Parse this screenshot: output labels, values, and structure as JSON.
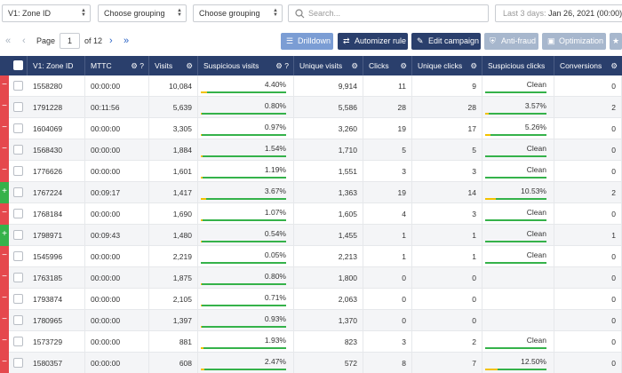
{
  "filters": {
    "zone_select": "V1: Zone ID",
    "grouping_1": "Choose grouping",
    "grouping_2": "Choose grouping",
    "search_placeholder": "Search...",
    "date_label": "Last 3 days:",
    "date_value": "Jan 26, 2021 (00:00) - J"
  },
  "pager": {
    "page_label": "Page",
    "current_page": "1",
    "of_label": "of 12"
  },
  "actions": {
    "drilldown": "Drilldown",
    "automizer_rule": "Automizer rule",
    "edit_campaign": "Edit campaign",
    "anti_fraud": "Anti-fraud",
    "optimization": "Optimization"
  },
  "table": {
    "headers": [
      "V1: Zone ID",
      "MTTC",
      "Visits",
      "Suspicious visits",
      "Unique visits",
      "Clicks",
      "Unique clicks",
      "Suspicious clicks",
      "Conversions"
    ],
    "rows": [
      {
        "status": "minus",
        "zone": "1558280",
        "mttc": "00:00:00",
        "visits": "10,084",
        "susp_visits": "4.40%",
        "sv_frac": 0.044,
        "unique_visits": "9,914",
        "clicks": "11",
        "unique_clicks": "9",
        "susp_clicks": "Clean",
        "sc_frac": 0,
        "conversions": "0"
      },
      {
        "status": "minus",
        "zone": "1791228",
        "mttc": "00:11:56",
        "visits": "5,639",
        "susp_visits": "0.80%",
        "sv_frac": 0.008,
        "unique_visits": "5,586",
        "clicks": "28",
        "unique_clicks": "28",
        "susp_clicks": "3.57%",
        "sc_frac": 0.0357,
        "conversions": "2"
      },
      {
        "status": "minus",
        "zone": "1604069",
        "mttc": "00:00:00",
        "visits": "3,305",
        "susp_visits": "0.97%",
        "sv_frac": 0.0097,
        "unique_visits": "3,260",
        "clicks": "19",
        "unique_clicks": "17",
        "susp_clicks": "5.26%",
        "sc_frac": 0.0526,
        "conversions": "0"
      },
      {
        "status": "minus",
        "zone": "1568430",
        "mttc": "00:00:00",
        "visits": "1,884",
        "susp_visits": "1.54%",
        "sv_frac": 0.0154,
        "unique_visits": "1,710",
        "clicks": "5",
        "unique_clicks": "5",
        "susp_clicks": "Clean",
        "sc_frac": 0,
        "conversions": "0"
      },
      {
        "status": "minus",
        "zone": "1776626",
        "mttc": "00:00:00",
        "visits": "1,601",
        "susp_visits": "1.19%",
        "sv_frac": 0.0119,
        "unique_visits": "1,551",
        "clicks": "3",
        "unique_clicks": "3",
        "susp_clicks": "Clean",
        "sc_frac": 0,
        "conversions": "0"
      },
      {
        "status": "plus",
        "zone": "1767224",
        "mttc": "00:09:17",
        "visits": "1,417",
        "susp_visits": "3.67%",
        "sv_frac": 0.0367,
        "unique_visits": "1,363",
        "clicks": "19",
        "unique_clicks": "14",
        "susp_clicks": "10.53%",
        "sc_frac": 0.1053,
        "conversions": "2"
      },
      {
        "status": "minus",
        "zone": "1768184",
        "mttc": "00:00:00",
        "visits": "1,690",
        "susp_visits": "1.07%",
        "sv_frac": 0.0107,
        "unique_visits": "1,605",
        "clicks": "4",
        "unique_clicks": "3",
        "susp_clicks": "Clean",
        "sc_frac": 0,
        "conversions": "0"
      },
      {
        "status": "plus",
        "zone": "1798971",
        "mttc": "00:09:43",
        "visits": "1,480",
        "susp_visits": "0.54%",
        "sv_frac": 0.0054,
        "unique_visits": "1,455",
        "clicks": "1",
        "unique_clicks": "1",
        "susp_clicks": "Clean",
        "sc_frac": 0,
        "conversions": "1"
      },
      {
        "status": "minus",
        "zone": "1545996",
        "mttc": "00:00:00",
        "visits": "2,219",
        "susp_visits": "0.05%",
        "sv_frac": 0.0005,
        "unique_visits": "2,213",
        "clicks": "1",
        "unique_clicks": "1",
        "susp_clicks": "Clean",
        "sc_frac": 0,
        "conversions": "0"
      },
      {
        "status": "minus",
        "zone": "1763185",
        "mttc": "00:00:00",
        "visits": "1,875",
        "susp_visits": "0.80%",
        "sv_frac": 0.008,
        "unique_visits": "1,800",
        "clicks": "0",
        "unique_clicks": "0",
        "susp_clicks": "",
        "sc_frac": null,
        "conversions": "0"
      },
      {
        "status": "minus",
        "zone": "1793874",
        "mttc": "00:00:00",
        "visits": "2,105",
        "susp_visits": "0.71%",
        "sv_frac": 0.0071,
        "unique_visits": "2,063",
        "clicks": "0",
        "unique_clicks": "0",
        "susp_clicks": "",
        "sc_frac": null,
        "conversions": "0"
      },
      {
        "status": "minus",
        "zone": "1780965",
        "mttc": "00:00:00",
        "visits": "1,397",
        "susp_visits": "0.93%",
        "sv_frac": 0.0093,
        "unique_visits": "1,370",
        "clicks": "0",
        "unique_clicks": "0",
        "susp_clicks": "",
        "sc_frac": null,
        "conversions": "0"
      },
      {
        "status": "minus",
        "zone": "1573729",
        "mttc": "00:00:00",
        "visits": "881",
        "susp_visits": "1.93%",
        "sv_frac": 0.0193,
        "unique_visits": "823",
        "clicks": "3",
        "unique_clicks": "2",
        "susp_clicks": "Clean",
        "sc_frac": 0,
        "conversions": "0"
      },
      {
        "status": "minus",
        "zone": "1580357",
        "mttc": "00:00:00",
        "visits": "608",
        "susp_visits": "2.47%",
        "sv_frac": 0.0247,
        "unique_visits": "572",
        "clicks": "8",
        "unique_clicks": "7",
        "susp_clicks": "12.50%",
        "sc_frac": 0.125,
        "conversions": "0"
      }
    ]
  },
  "colors": {
    "header_bg": "#2a3f6c",
    "bar_green": "#35b24a",
    "bar_yellow": "#f2c200",
    "status_red": "#e5484d",
    "status_green": "#35b24a",
    "accent_blue": "#2c64c6"
  },
  "icons": {
    "first_page": "double-chevron-left-icon",
    "prev_page": "chevron-left-icon",
    "next_page": "chevron-right-icon",
    "last_page": "double-chevron-right-icon",
    "search": "search-icon",
    "settings": "gear-icon",
    "help": "question-icon",
    "drilldown": "filter-icon",
    "automizer": "swap-icon",
    "edit": "pencil-icon",
    "anti_fraud": "shield-icon",
    "optimization": "window-icon",
    "favorite": "star-icon"
  }
}
